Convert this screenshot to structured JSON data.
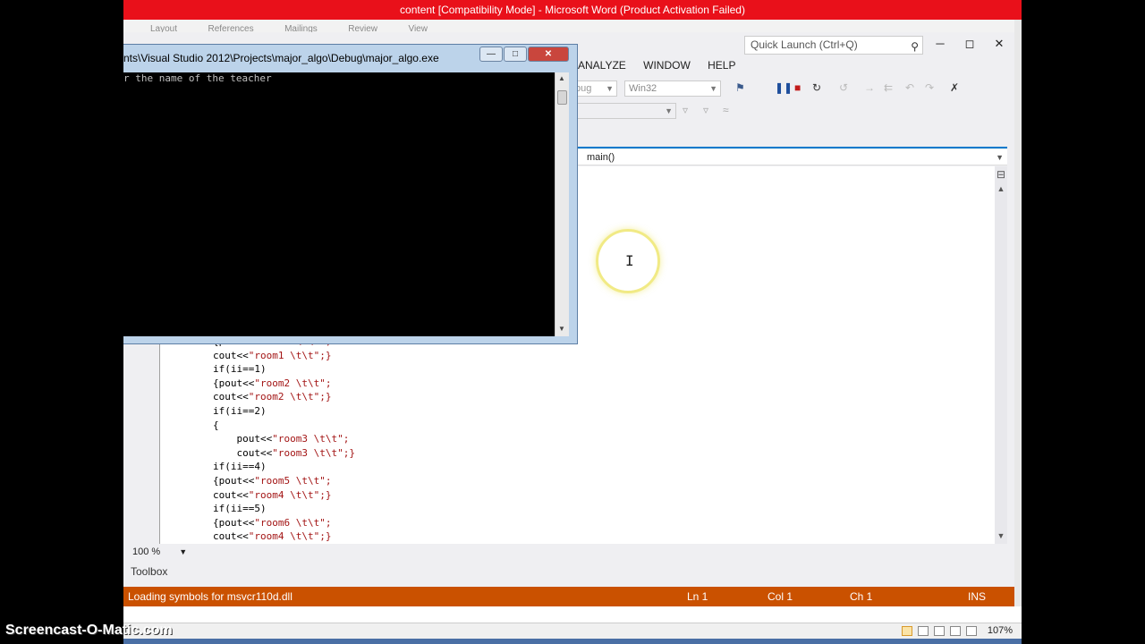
{
  "word": {
    "title": "content [Compatibility Mode] - Microsoft Word (Product Activation Failed)",
    "ribbon_tabs": [
      "Layout",
      "References",
      "Mailings",
      "Review",
      "View"
    ],
    "zoom": "107%"
  },
  "vs": {
    "quick_launch": "Quick Launch (Ctrl+Q)",
    "menu": [
      "ANALYZE",
      "WINDOW",
      "HELP"
    ],
    "config": "bug",
    "platform": "Win32",
    "nav_function": "main()",
    "code_lines": [
      [
        "{pout<<",
        "\"room1 \\t\\t\";"
      ],
      [
        "cout<<",
        "\"room1 \\t\\t\";}"
      ],
      [
        "if(ii==1)",
        ""
      ],
      [
        "{pout<<",
        "\"room2 \\t\\t\";"
      ],
      [
        "cout<<",
        "\"room2 \\t\\t\";}"
      ],
      [
        "if(ii==2)",
        ""
      ],
      [
        "{",
        ""
      ],
      [
        "    pout<<",
        "\"room3 \\t\\t\";"
      ],
      [
        "    cout<<",
        "\"room3 \\t\\t\";}"
      ],
      [
        "if(ii==4)",
        ""
      ],
      [
        "{pout<<",
        "\"room5 \\t\\t\";"
      ],
      [
        "cout<<",
        "\"room4 \\t\\t\";}"
      ],
      [
        "if(ii==5)",
        ""
      ],
      [
        "{pout<<",
        "\"room6 \\t\\t\";"
      ],
      [
        "cout<<",
        "\"room4 \\t\\t\";}"
      ]
    ],
    "zoom": "100 %",
    "toolbox": "Toolbox",
    "status": {
      "message": "Loading symbols for msvcr110d.dll",
      "ln": "Ln 1",
      "col": "Col 1",
      "ch": "Ch 1",
      "mode": "INS"
    }
  },
  "console": {
    "title": "nts\\Visual Studio 2012\\Projects\\major_algo\\Debug\\major_algo.exe",
    "output": "r the name of the teacher"
  },
  "watermark": "Screencast-O-Matic.com"
}
